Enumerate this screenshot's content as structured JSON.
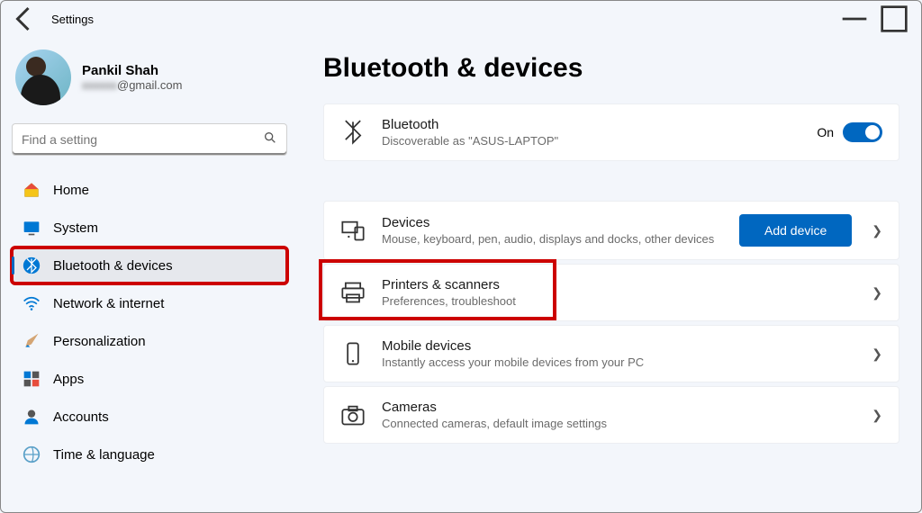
{
  "window": {
    "title": "Settings"
  },
  "profile": {
    "name": "Pankil Shah",
    "email_prefix": "xxxxxx",
    "email_suffix": "@gmail.com"
  },
  "search": {
    "placeholder": "Find a setting"
  },
  "nav": {
    "home": "Home",
    "system": "System",
    "bluetooth": "Bluetooth & devices",
    "network": "Network & internet",
    "personalization": "Personalization",
    "apps": "Apps",
    "accounts": "Accounts",
    "time": "Time & language"
  },
  "page": {
    "title": "Bluetooth & devices"
  },
  "bluetooth_card": {
    "title": "Bluetooth",
    "sub": "Discoverable as \"ASUS-LAPTOP\"",
    "state": "On"
  },
  "devices_card": {
    "title": "Devices",
    "sub": "Mouse, keyboard, pen, audio, displays and docks, other devices",
    "button": "Add device"
  },
  "printers_card": {
    "title": "Printers & scanners",
    "sub": "Preferences, troubleshoot"
  },
  "mobile_card": {
    "title": "Mobile devices",
    "sub": "Instantly access your mobile devices from your PC"
  },
  "cameras_card": {
    "title": "Cameras",
    "sub": "Connected cameras, default image settings"
  }
}
